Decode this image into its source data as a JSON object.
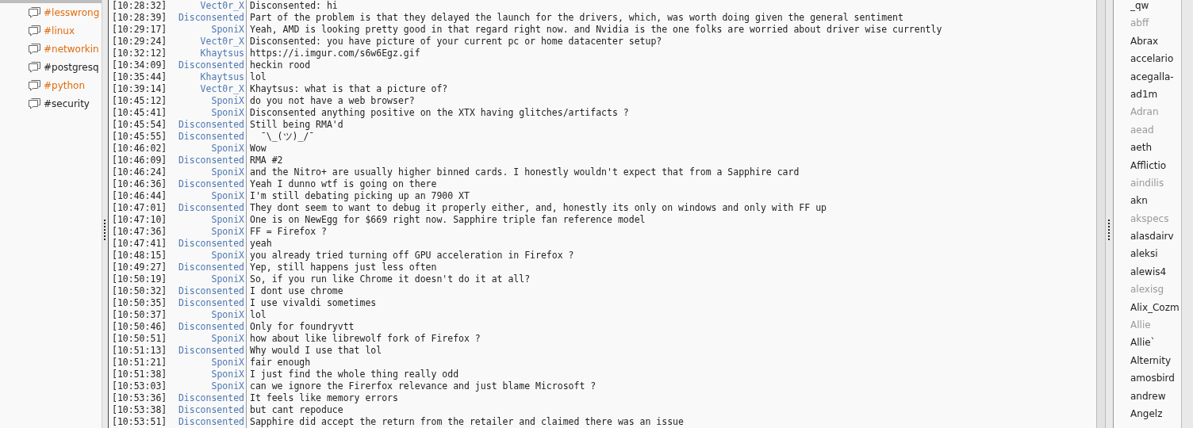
{
  "channels": [
    {
      "name": "#lesswrong",
      "highlighted": true
    },
    {
      "name": "#linux",
      "highlighted": true
    },
    {
      "name": "#networkin",
      "highlighted": true
    },
    {
      "name": "#postgresq",
      "highlighted": false
    },
    {
      "name": "#python",
      "highlighted": true
    },
    {
      "name": "#security",
      "highlighted": false
    }
  ],
  "messages": [
    {
      "time": "[10:28:32]",
      "nick": "Vect0r_X",
      "text": "Disconsented: hi"
    },
    {
      "time": "[10:28:39]",
      "nick": "Disconsented",
      "text": "Part of the problem is that they delayed the launch for the drivers, which, was worth doing given the general sentiment"
    },
    {
      "time": "[10:29:17]",
      "nick": "SponiX",
      "text": "Yeah, AMD is looking pretty good in that regard right now. and Nvidia is the one folks are worried about driver wise currently"
    },
    {
      "time": "[10:29:24]",
      "nick": "Vect0r_X",
      "text": "Disconsented: you have picture of your current pc or home datacenter setup?"
    },
    {
      "time": "[10:32:12]",
      "nick": "Khaytsus",
      "text": "https://i.imgur.com/s6w6Egz.gif"
    },
    {
      "time": "[10:34:09]",
      "nick": "Disconsented",
      "text": "heckin rood"
    },
    {
      "time": "[10:35:44]",
      "nick": "Khaytsus",
      "text": "lol"
    },
    {
      "time": "[10:39:14]",
      "nick": "Vect0r_X",
      "text": "Khaytsus: what is that a picture of?"
    },
    {
      "time": "[10:45:12]",
      "nick": "SponiX",
      "text": "do you not have a web browser?"
    },
    {
      "time": "[10:45:41]",
      "nick": "SponiX",
      "text": "Disconsented anything positive on the XTX having glitches/artifacts ?"
    },
    {
      "time": "[10:45:54]",
      "nick": "Disconsented",
      "text": "Still being RMA'd"
    },
    {
      "time": "[10:45:55]",
      "nick": "Disconsented",
      "text": "  ¯\\_(ツ)_/¯"
    },
    {
      "time": "[10:46:02]",
      "nick": "SponiX",
      "text": "Wow"
    },
    {
      "time": "[10:46:09]",
      "nick": "Disconsented",
      "text": "RMA #2"
    },
    {
      "time": "[10:46:24]",
      "nick": "SponiX",
      "text": "and the Nitro+ are usually higher binned cards. I honestly wouldn't expect that from a Sapphire card"
    },
    {
      "time": "[10:46:36]",
      "nick": "Disconsented",
      "text": "Yeah I dunno wtf is going on there"
    },
    {
      "time": "[10:46:44]",
      "nick": "SponiX",
      "text": "I'm still debating picking up an 7900 XT"
    },
    {
      "time": "[10:47:01]",
      "nick": "Disconsented",
      "text": "They dont seem to want to debug it properly either, and, honestly its only on windows and only with FF up"
    },
    {
      "time": "[10:47:10]",
      "nick": "SponiX",
      "text": "One is on NewEgg for $669 right now. Sapphire triple fan reference model"
    },
    {
      "time": "[10:47:36]",
      "nick": "SponiX",
      "text": "FF = Firefox ?"
    },
    {
      "time": "[10:47:41]",
      "nick": "Disconsented",
      "text": "yeah"
    },
    {
      "time": "[10:48:15]",
      "nick": "SponiX",
      "text": "you already tried turning off GPU acceleration in Firefox ?"
    },
    {
      "time": "[10:49:27]",
      "nick": "Disconsented",
      "text": "Yep, still happens just less often"
    },
    {
      "time": "[10:50:19]",
      "nick": "SponiX",
      "text": "So, if you run like Chrome it doesn't do it at all?"
    },
    {
      "time": "[10:50:32]",
      "nick": "Disconsented",
      "text": "I dont use chrome"
    },
    {
      "time": "[10:50:35]",
      "nick": "Disconsented",
      "text": "I use vivaldi sometimes"
    },
    {
      "time": "[10:50:37]",
      "nick": "SponiX",
      "text": "lol"
    },
    {
      "time": "[10:50:46]",
      "nick": "Disconsented",
      "text": "Only for foundryvtt"
    },
    {
      "time": "[10:50:51]",
      "nick": "SponiX",
      "text": "how about like librewolf fork of Firefox ?"
    },
    {
      "time": "[10:51:13]",
      "nick": "Disconsented",
      "text": "Why would I use that lol"
    },
    {
      "time": "[10:51:21]",
      "nick": "SponiX",
      "text": "fair enough"
    },
    {
      "time": "[10:51:38]",
      "nick": "SponiX",
      "text": "I just find the whole thing really odd"
    },
    {
      "time": "[10:53:03]",
      "nick": "SponiX",
      "text": "can we ignore the Firerfox relevance and just blame Microsoft ?"
    },
    {
      "time": "[10:53:36]",
      "nick": "Disconsented",
      "text": "It feels like memory errors"
    },
    {
      "time": "[10:53:38]",
      "nick": "Disconsented",
      "text": "but cant repoduce"
    },
    {
      "time": "[10:53:51]",
      "nick": "Disconsented",
      "text": "Sapphire did accept the return from the retailer and claimed there was an issue"
    }
  ],
  "users": [
    {
      "name": "_qw",
      "away": false
    },
    {
      "name": "abff",
      "away": true
    },
    {
      "name": "Abrax",
      "away": false
    },
    {
      "name": "accelario",
      "away": false
    },
    {
      "name": "acegalla-",
      "away": false
    },
    {
      "name": "ad1m",
      "away": false
    },
    {
      "name": "Adran",
      "away": true
    },
    {
      "name": "aead",
      "away": true
    },
    {
      "name": "aeth",
      "away": false
    },
    {
      "name": "Afflictio",
      "away": false
    },
    {
      "name": "aindilis",
      "away": true
    },
    {
      "name": "akn",
      "away": false
    },
    {
      "name": "akspecs",
      "away": true
    },
    {
      "name": "alasdairv",
      "away": false
    },
    {
      "name": "aleksi",
      "away": false
    },
    {
      "name": "alewis4",
      "away": false
    },
    {
      "name": "alexisg",
      "away": true
    },
    {
      "name": "Alix_Cozm",
      "away": false
    },
    {
      "name": "Allie",
      "away": true
    },
    {
      "name": "Allie`",
      "away": false
    },
    {
      "name": "Alternity",
      "away": false
    },
    {
      "name": "amosbird",
      "away": false
    },
    {
      "name": "andrew",
      "away": false
    },
    {
      "name": "Angelz",
      "away": false
    }
  ]
}
